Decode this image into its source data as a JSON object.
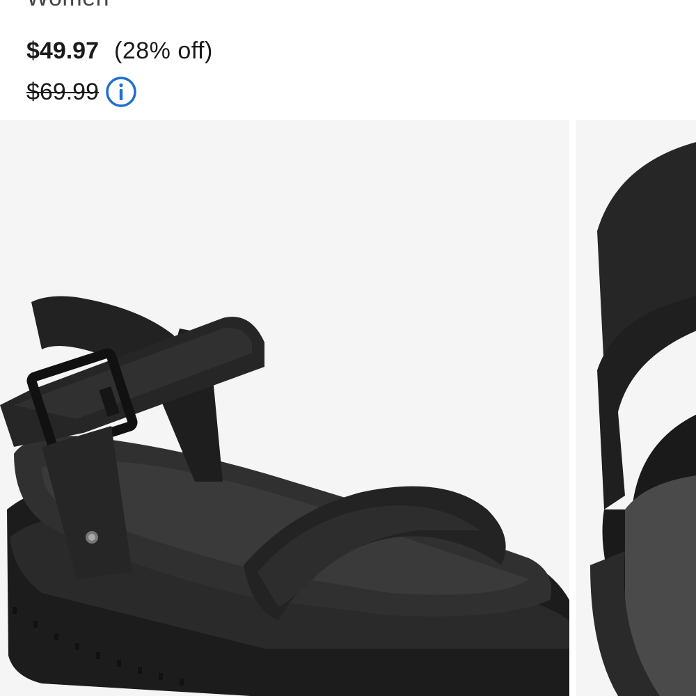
{
  "product": {
    "subtitle": "Women",
    "sale_price": "$49.97",
    "discount": "(28% off)",
    "original_price": "$69.99"
  },
  "icons": {
    "info": "info-circle-icon"
  },
  "colors": {
    "accent_blue": "#1f6fd0",
    "image_background": "#f5f5f5",
    "text": "#1a1a1a"
  },
  "gallery": {
    "images": [
      {
        "label": "product-image-sandal-angle"
      },
      {
        "label": "product-image-sandal-back-closeup"
      }
    ]
  }
}
